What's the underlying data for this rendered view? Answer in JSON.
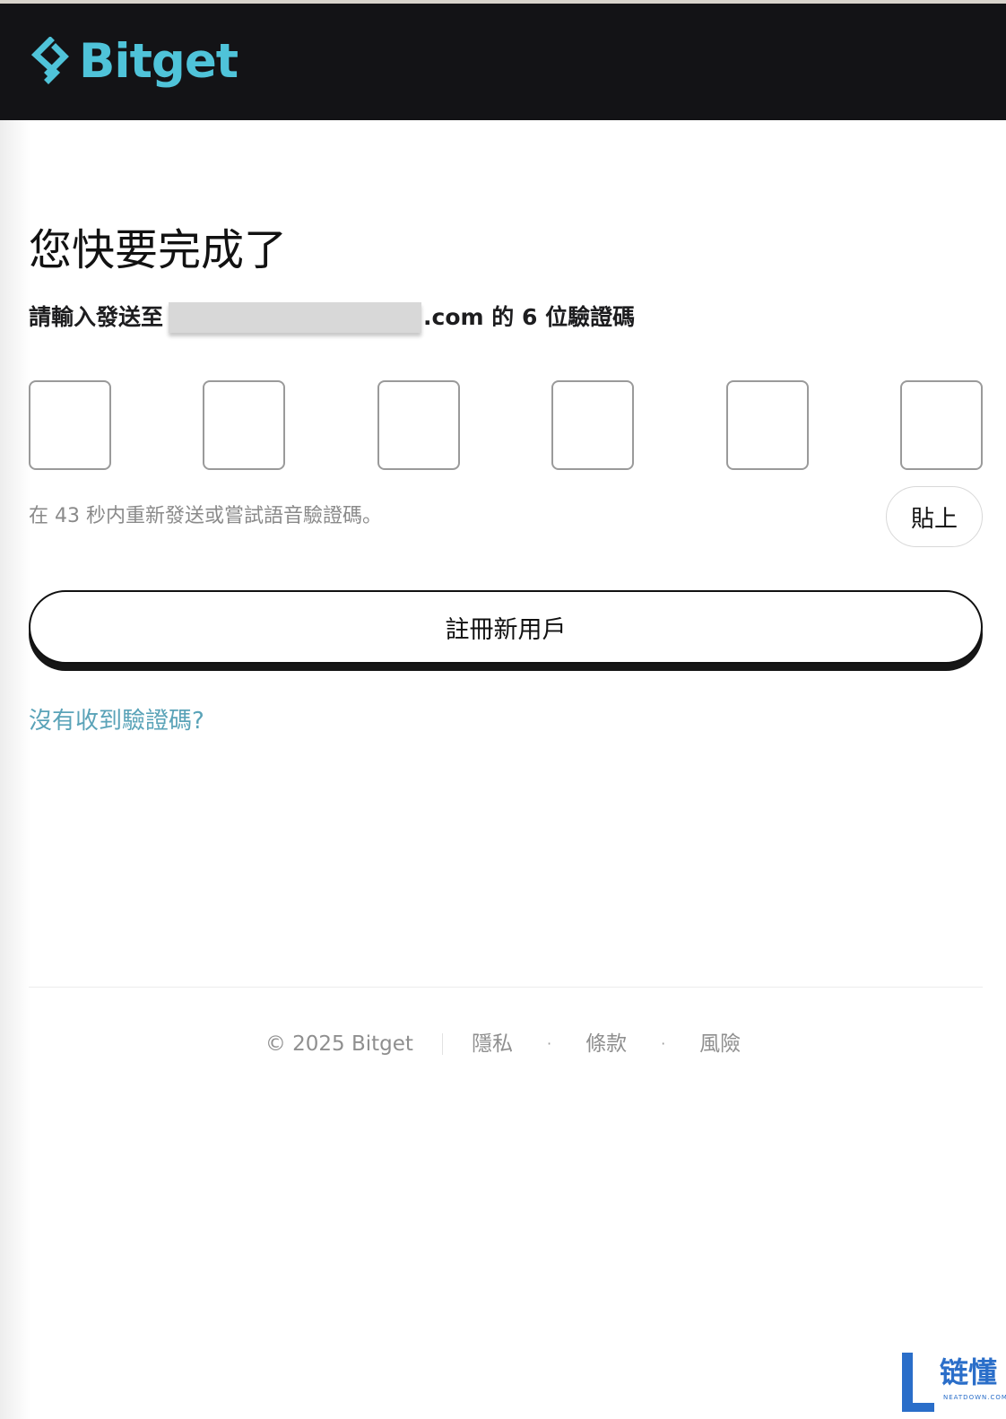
{
  "brand": {
    "name": "Bitget",
    "color": "#4fc3d9"
  },
  "verify": {
    "heading": "您快要完成了",
    "subtitle_prefix": "請輸入發送至",
    "subtitle_suffix": ".com 的 6 位驗證碼",
    "code_length": 6,
    "code_values": [
      "",
      "",
      "",
      "",
      "",
      ""
    ],
    "resend_text": "在 43 秒内重新發送或嘗試語音驗證碼。",
    "paste_label": "貼上",
    "register_label": "註冊新用戶",
    "no_code_link": "沒有收到驗證碼?",
    "link_color": "#5aa3b8"
  },
  "footer": {
    "copyright": "© 2025 Bitget",
    "privacy": "隱私",
    "terms": "條款",
    "risk": "風險",
    "dot": "·"
  },
  "watermark": {
    "cn": "链懂",
    "en": "NEATDOWN.COM",
    "color": "#2a6ec9"
  }
}
